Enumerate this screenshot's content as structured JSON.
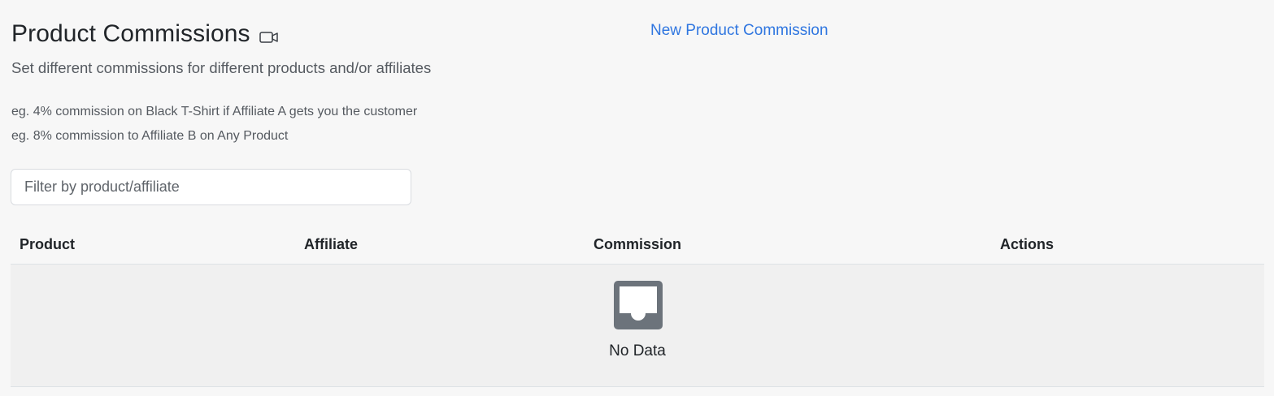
{
  "header": {
    "title": "Product Commissions",
    "video_icon": "video-camera-icon",
    "new_link": "New Product Commission",
    "subtitle": "Set different commissions for different products and/or affiliates"
  },
  "examples": [
    "eg. 4% commission on Black T-Shirt if Affiliate A gets you the customer",
    "eg. 8% commission to Affiliate B on Any Product"
  ],
  "filter": {
    "placeholder": "Filter by product/affiliate",
    "value": ""
  },
  "table": {
    "columns": [
      "Product",
      "Affiliate",
      "Commission",
      "Actions"
    ],
    "rows": [],
    "empty_icon": "inbox-icon",
    "empty_text": "No Data"
  },
  "colors": {
    "link": "#2f76e0",
    "text": "#212529",
    "muted": "#555a60",
    "empty_bg": "#f0f0f0",
    "icon": "#6c737b"
  }
}
